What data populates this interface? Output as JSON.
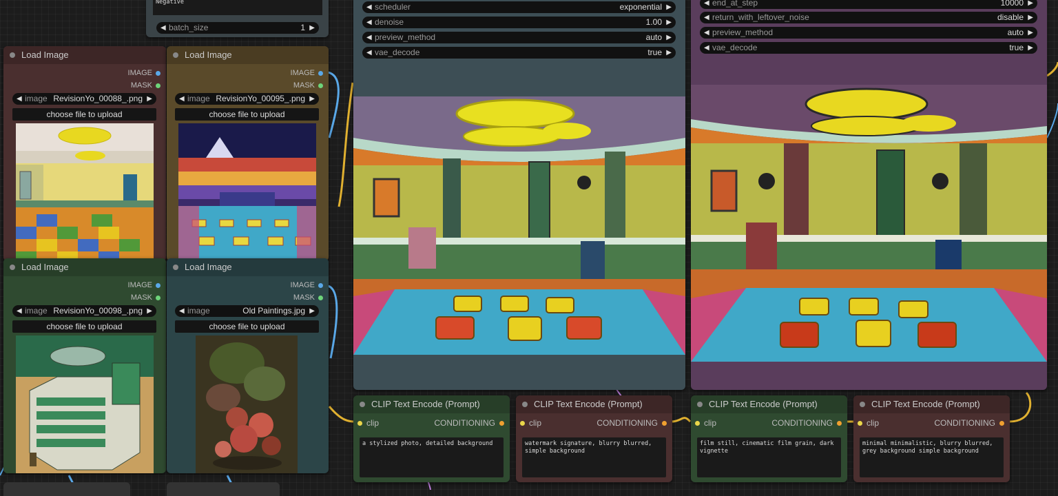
{
  "top_left_node": {
    "negative_text": "Negative",
    "batch_size": {
      "label": "batch_size",
      "value": "1"
    }
  },
  "load_image_nodes": [
    {
      "title": "Load Image",
      "out_image": "IMAGE",
      "out_mask": "MASK",
      "image_label": "image",
      "image_value": "RevisionYo_00088_.png",
      "upload": "choose file to upload"
    },
    {
      "title": "Load Image",
      "out_image": "IMAGE",
      "out_mask": "MASK",
      "image_label": "image",
      "image_value": "RevisionYo_00095_.png",
      "upload": "choose file to upload"
    },
    {
      "title": "Load Image",
      "out_image": "IMAGE",
      "out_mask": "MASK",
      "image_label": "image",
      "image_value": "RevisionYo_00098_.png",
      "upload": "choose file to upload"
    },
    {
      "title": "Load Image",
      "out_image": "IMAGE",
      "out_mask": "MASK",
      "image_label": "image",
      "image_value": "Old Paintings.jpg",
      "upload": "choose file to upload"
    }
  ],
  "sampler_1": {
    "widgets": [
      {
        "label": "scheduler",
        "value": "exponential"
      },
      {
        "label": "denoise",
        "value": "1.00"
      },
      {
        "label": "preview_method",
        "value": "auto"
      },
      {
        "label": "vae_decode",
        "value": "true"
      }
    ]
  },
  "sampler_2": {
    "widgets": [
      {
        "label": "end_at_step",
        "value": "10000"
      },
      {
        "label": "return_with_leftover_noise",
        "value": "disable"
      },
      {
        "label": "preview_method",
        "value": "auto"
      },
      {
        "label": "vae_decode",
        "value": "true"
      }
    ]
  },
  "clip_nodes": [
    {
      "title": "CLIP Text Encode (Prompt)",
      "input": "clip",
      "output": "CONDITIONING",
      "text": "a stylized photo, detailed background"
    },
    {
      "title": "CLIP Text Encode (Prompt)",
      "input": "clip",
      "output": "CONDITIONING",
      "text": "watermark signature, blurry blurred, simple background"
    },
    {
      "title": "CLIP Text Encode (Prompt)",
      "input": "clip",
      "output": "CONDITIONING",
      "text": "film still, cinematic film grain, dark vignette"
    },
    {
      "title": "CLIP Text Encode (Prompt)",
      "input": "clip",
      "output": "CONDITIONING",
      "text": "minimal minimalistic, blurry blurred, grey background simple background"
    }
  ],
  "colors": {
    "canvas": "#1c1c1c",
    "node_red": "#4a2f2f",
    "node_brown": "#5a4a2a",
    "node_green": "#2f4a30",
    "node_teal": "#2c4548",
    "node_slate": "#3d4e55",
    "node_purple": "#5a3d5c",
    "wire_yellow": "#e0b030",
    "wire_blue": "#5aa8e8"
  }
}
